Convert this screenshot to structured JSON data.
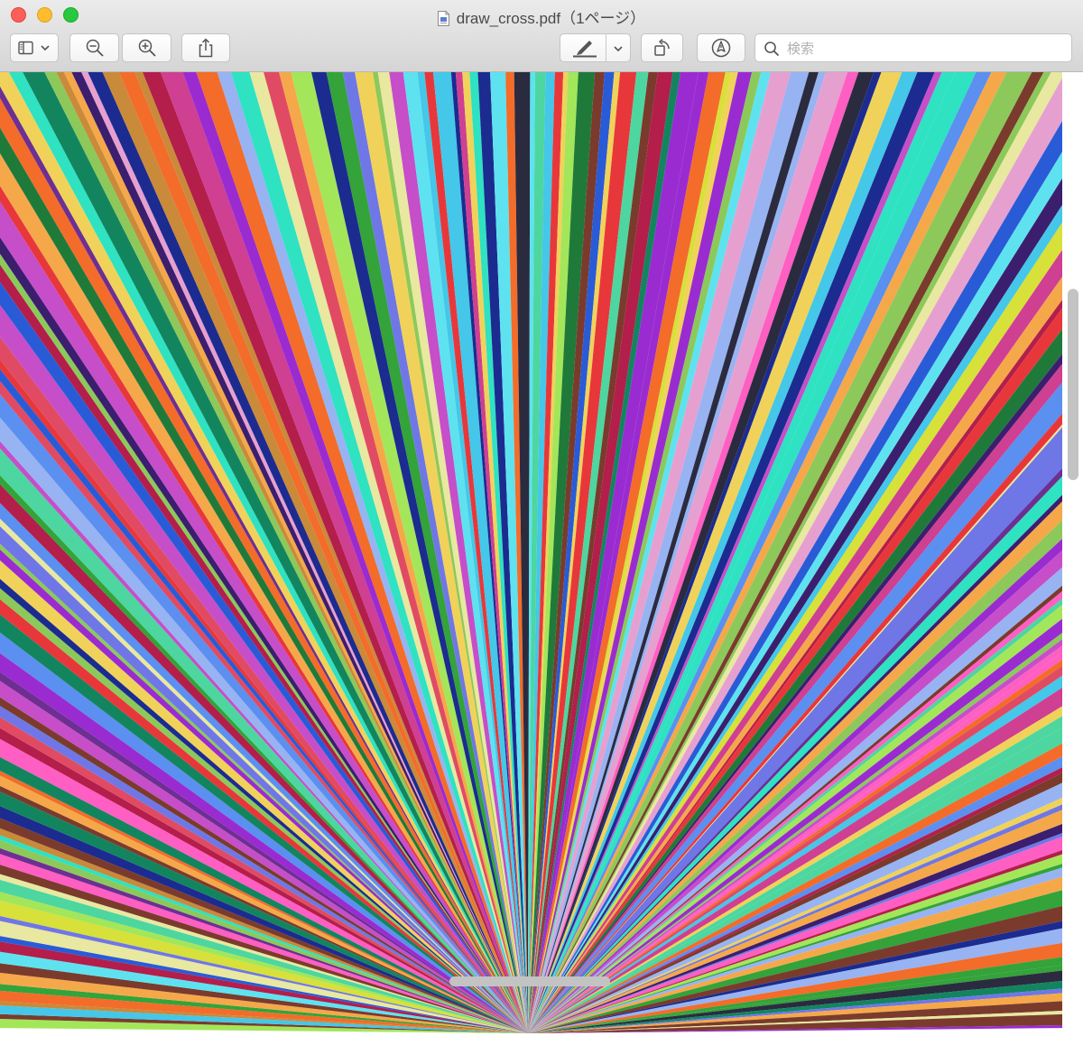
{
  "window": {
    "title": "draw_cross.pdf（1ページ）",
    "title_icon": "pdf-document-icon"
  },
  "traffic_lights": {
    "close": "#fe5f57",
    "minimize": "#febc2e",
    "maximize": "#28c840"
  },
  "toolbar": {
    "sidebar_toggle_icon": "sidebar-icon",
    "sidebar_menu_icon": "chevron-down-icon",
    "zoom_out_icon": "zoom-out-icon",
    "zoom_in_icon": "zoom-in-icon",
    "share_icon": "share-icon",
    "highlight_icon": "highlighter-icon",
    "highlight_menu_icon": "chevron-down-icon",
    "rotate_icon": "rotate-icon",
    "markup_icon": "markup-pen-icon",
    "search": {
      "placeholder": "検索",
      "value": "",
      "icon": "search-icon"
    }
  },
  "document": {
    "page_count": 1,
    "stripe_palette": [
      "#e8373a",
      "#2a5bd7",
      "#f5a84a",
      "#1f7a3a",
      "#c64ec9",
      "#5ee2f0",
      "#d8e03a",
      "#7a3b2d",
      "#4dd6a0",
      "#3b1e6e",
      "#ff5ec2",
      "#8cc95a",
      "#1c2b8f",
      "#f36c2a",
      "#6f77e6",
      "#b31e4b",
      "#44c7e8",
      "#a3e65a",
      "#2b2b3f",
      "#e6a0d0",
      "#12855f",
      "#cf3f92",
      "#97b3f2",
      "#f0d25a",
      "#6d2f91",
      "#33a33a",
      "#e04b63",
      "#5b8ff0",
      "#c98a3a",
      "#2ee2c2",
      "#9a2bd1",
      "#e8e8a0"
    ]
  }
}
